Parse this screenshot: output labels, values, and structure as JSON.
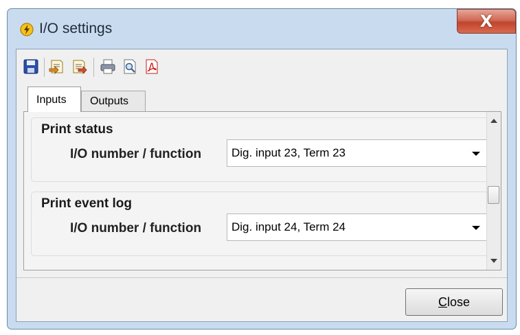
{
  "window": {
    "title": "I/O settings",
    "close_glyph": "X"
  },
  "toolbar": {
    "buttons": [
      {
        "icon": "save-icon"
      },
      {
        "icon": "import-icon"
      },
      {
        "icon": "export-icon"
      },
      {
        "icon": "print-icon"
      },
      {
        "icon": "print-preview-icon"
      },
      {
        "icon": "pdf-icon"
      }
    ]
  },
  "tabs": {
    "inputs": "Inputs",
    "outputs": "Outputs"
  },
  "groups": [
    {
      "title": "Print status",
      "label": "I/O number / function",
      "value": "Dig. input 23, Term  23"
    },
    {
      "title": "Print event log",
      "label": "I/O number / function",
      "value": "Dig. input 24, Term  24"
    }
  ],
  "footer": {
    "close_mnemonic": "C",
    "close_rest": "lose"
  }
}
